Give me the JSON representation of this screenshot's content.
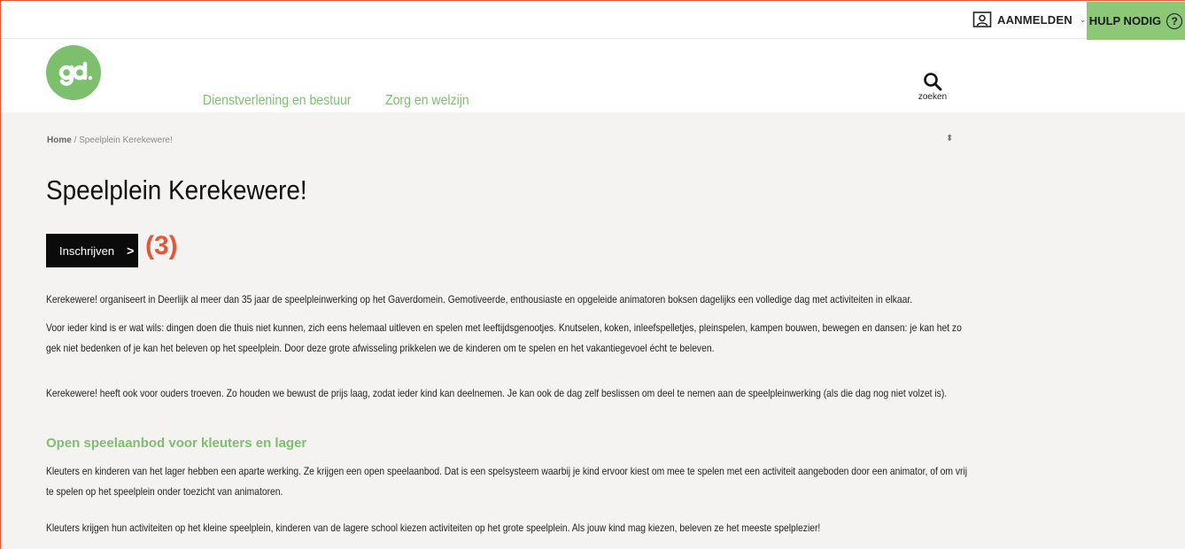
{
  "topbar": {
    "login_label": "AANMELDEN",
    "login_icon": "user-card-icon",
    "help_label": "HULP NODIG",
    "help_icon": "?",
    "help_color": "#8cc878"
  },
  "header": {
    "logo_icon": "gd-logo",
    "nav": [
      "Dienstverlening en bestuur",
      "Zorg en welzijn"
    ],
    "search_label": "zoeken",
    "accent_color": "#7cc06d"
  },
  "breadcrumb": {
    "home": "Home",
    "separator": "/",
    "current": "Speelplein Kerekewere!"
  },
  "page": {
    "title": "Speelplein Kerekewere!",
    "cta_label": "Inschrijven",
    "annotation": "(3)",
    "paragraphs": [
      "Kerekewere! organiseert in Deerlijk al meer dan 35 jaar de speelpleinwerking op het Gaverdomein. Gemotiveerde, enthousiaste en opgeleide animatoren boksen dagelijks een volledige dag met activiteiten in elkaar.",
      "Voor ieder kind is er wat wils: dingen doen die thuis niet kunnen, zich eens helemaal uitleven en spelen met leeftijdsgenootjes. Knutselen, koken, inleefspelletjes, pleinspelen, kampen bouwen, bewegen en dansen: je kan het zo gek niet bedenken of je kan het beleven op het speelplein. Door deze grote afwisseling prikkelen we de kinderen om te spelen en het vakantiegevoel écht te beleven.",
      "Kerekewere! heeft ook voor ouders troeven. Zo houden we bewust de prijs laag, zodat ieder kind kan deelnemen. Je kan ook de dag zelf beslissen om deel te nemen aan de speelpleinwerking (als die dag nog niet volzet is)."
    ],
    "section_heading": "Open speelaanbod voor kleuters en lager",
    "section_paragraphs": [
      "Kleuters en kinderen van het lager hebben een aparte werking. Ze krijgen een open speelaanbod. Dat is een spelsysteem waarbij je kind ervoor kiest om mee te spelen met een activiteit aangeboden door een animator, of om vrij te spelen op het speelplein onder toezicht van animatoren.",
      "Kleuters krijgen hun activiteiten op het kleine speelplein, kinderen van de lagere school kiezen activiteiten op het grote speelplein. Als jouw kind mag kiezen, beleven ze het meeste spelplezier!"
    ]
  }
}
